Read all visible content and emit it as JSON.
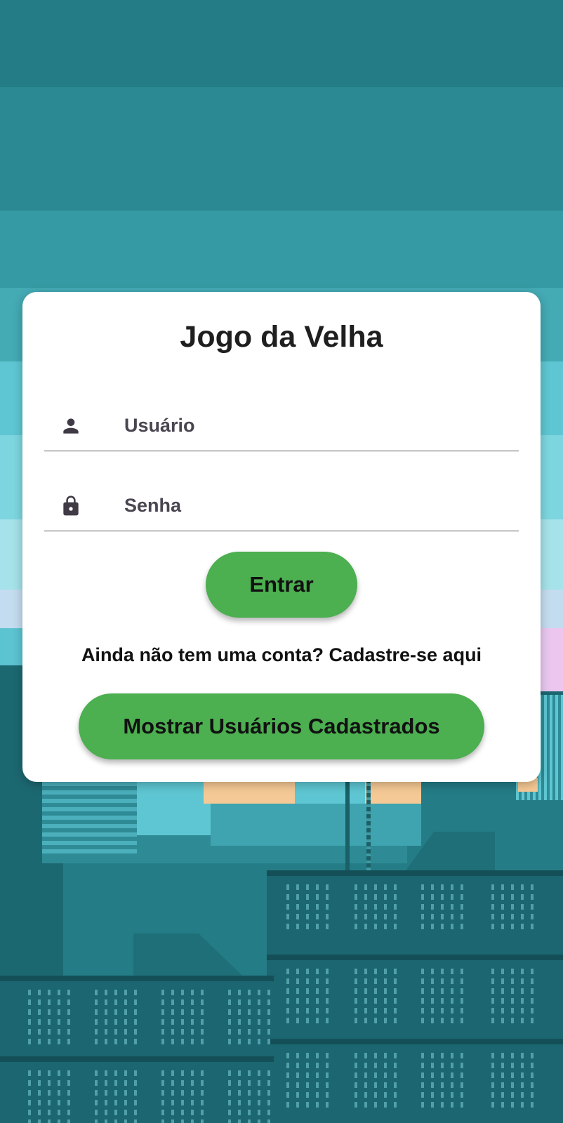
{
  "app": {
    "title": "Jogo da Velha"
  },
  "login": {
    "username": {
      "placeholder": "Usuário",
      "value": "",
      "icon": "person-icon"
    },
    "password": {
      "placeholder": "Senha",
      "value": "",
      "icon": "lock-icon"
    },
    "enter_label": "Entrar",
    "signup_prompt": "Ainda não tem uma conta? Cadastre-se aqui",
    "show_users_label": "Mostrar Usuários Cadastrados"
  },
  "colors": {
    "button": "#4caf50",
    "card": "#ffffff",
    "background": "#247c86"
  }
}
